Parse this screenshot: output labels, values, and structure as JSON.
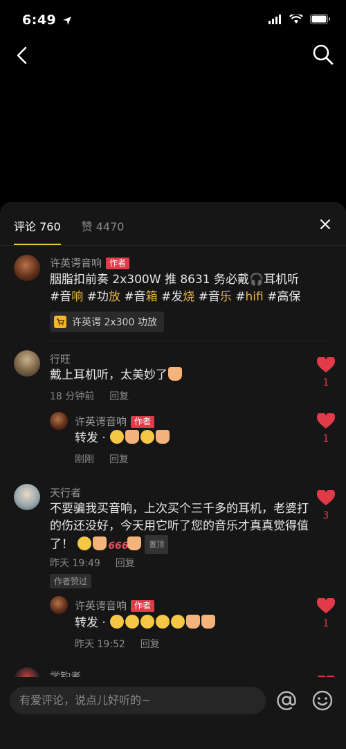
{
  "status": {
    "time": "6:49"
  },
  "sheet": {
    "tab_comments": "评论 760",
    "tab_likes": "赞 4470"
  },
  "post": {
    "author": "许英谔音响",
    "author_badge": "作者",
    "text_line1": "胭脂扣前奏 2x300W 推 8631 务必戴🎧耳机听",
    "hashtags": [
      {
        "hash": "#音",
        "hl": "响"
      },
      {
        "hash": "#功",
        "hl": "放"
      },
      {
        "hash": "#音",
        "hl": "箱"
      },
      {
        "hash": "#发",
        "hl": "烧"
      },
      {
        "hash": "#音",
        "hl": "乐"
      },
      {
        "hash": "#",
        "hl": "hifi"
      },
      {
        "hash": "#高保",
        "hl": ""
      }
    ],
    "product": "许英谔 2x300 功放"
  },
  "comments": [
    {
      "name": "行旺",
      "text": "戴上耳机听，太美妙了",
      "time": "18 分钟前",
      "reply": "回复",
      "likes": "1",
      "replies": [
        {
          "name": "许英谔音响",
          "badge": "作者",
          "text": "转发 ·",
          "time": "刚刚",
          "reply": "回复",
          "likes": "1"
        }
      ]
    },
    {
      "name": "天行者",
      "text": "不要骗我买音响，上次买个三千多的耳机，老婆打的伤还没好，今天用它听了您的音乐才真真觉得值了！",
      "pin": "置顶",
      "time": "昨天 19:49",
      "reply": "回复",
      "liked_tag": "作者赞过",
      "likes": "3",
      "replies": [
        {
          "name": "许英谔音响",
          "badge": "作者",
          "text": "转发 ·",
          "time": "昨天 19:52",
          "reply": "回复",
          "likes": "1"
        }
      ]
    },
    {
      "name": "学钓者"
    }
  ],
  "input": {
    "placeholder": "有爱评论，说点儿好听的~"
  },
  "colors": {
    "accent": "#e33a49",
    "tab_underline": "#f5c330",
    "hashtag": "#e9b645"
  }
}
